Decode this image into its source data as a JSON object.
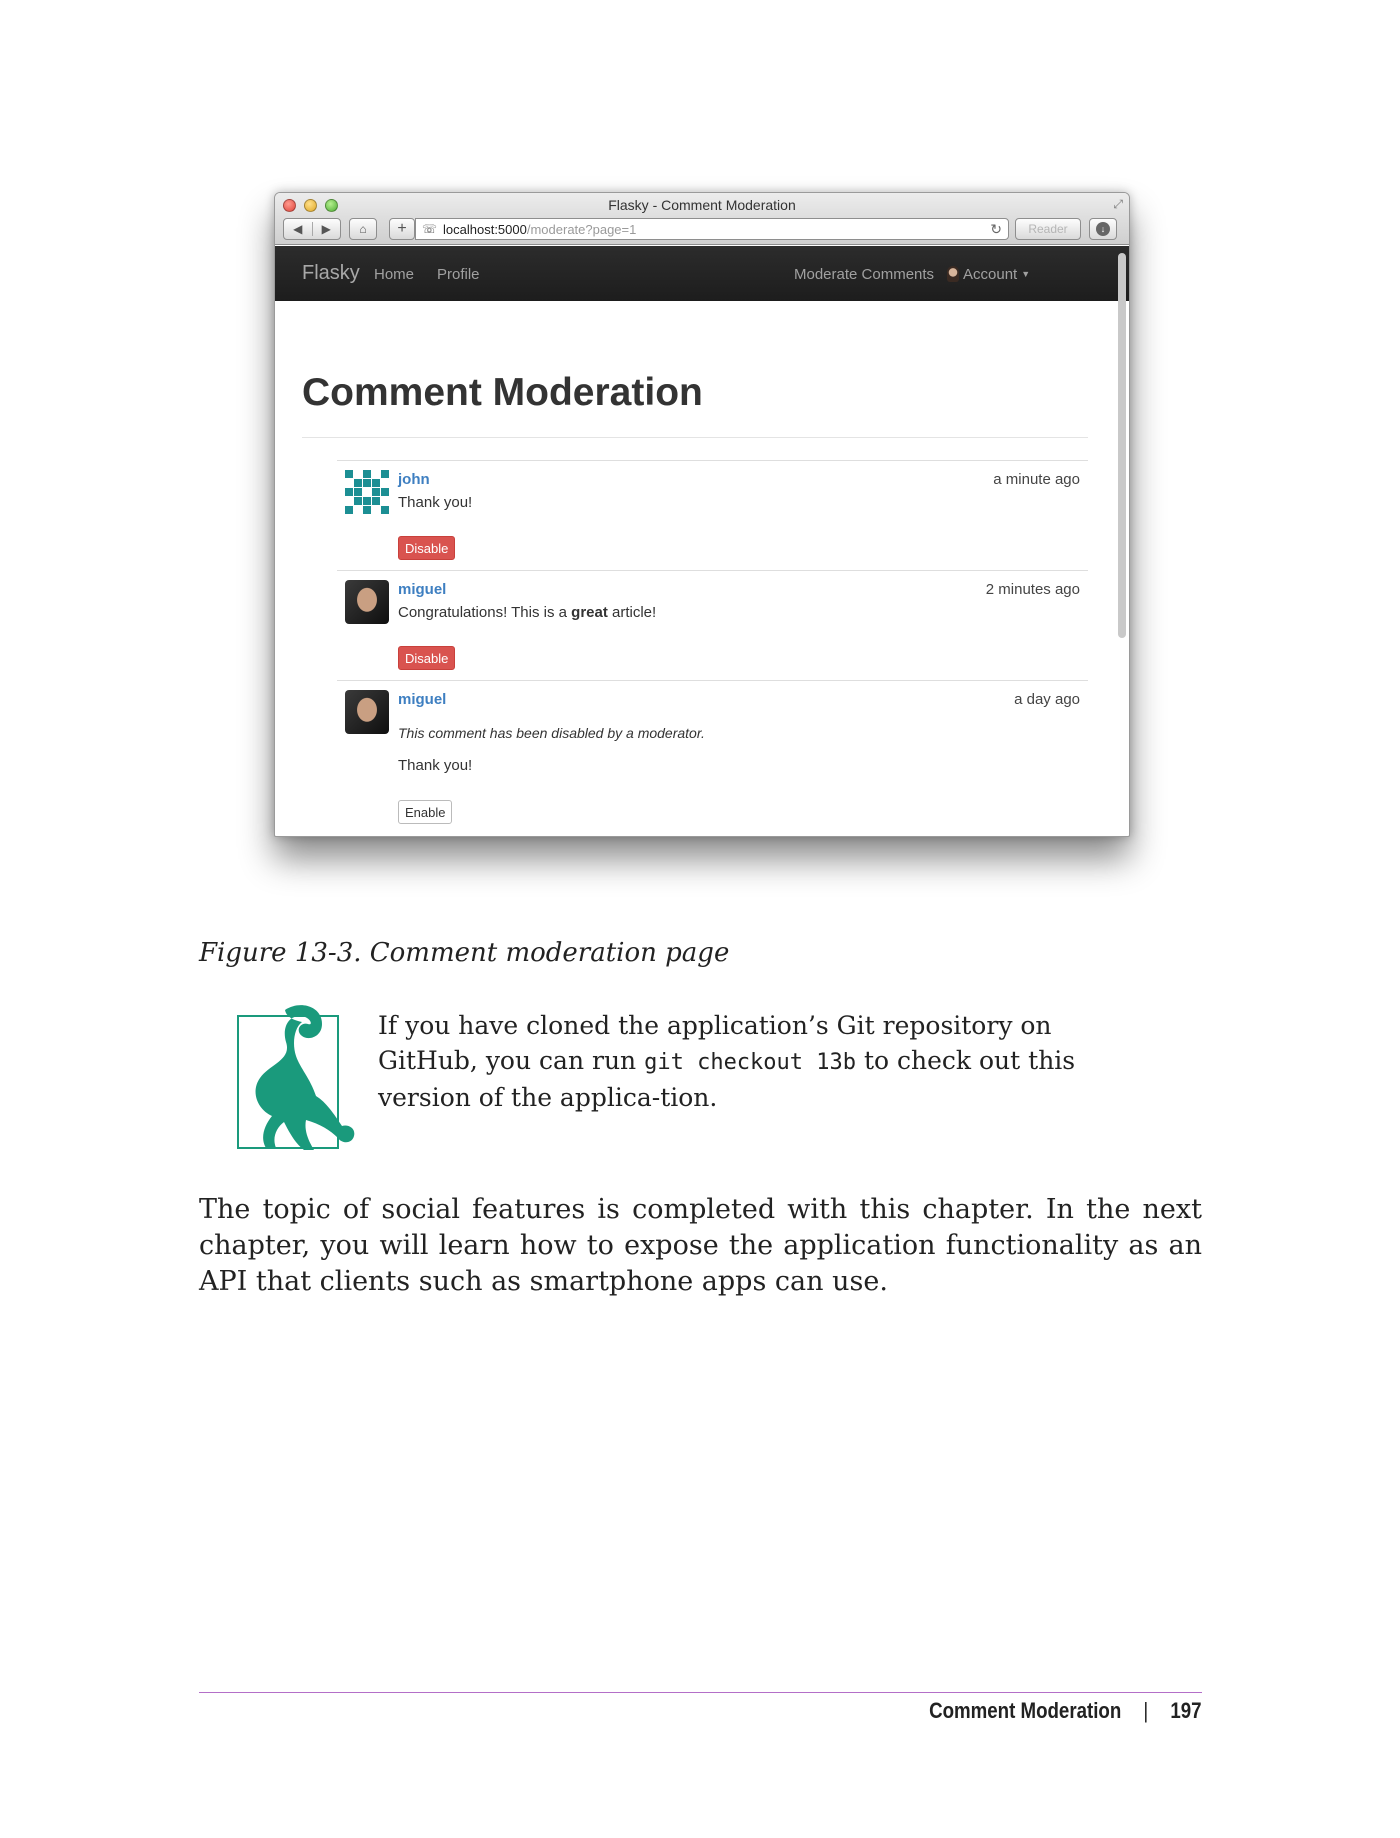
{
  "browser": {
    "window_title": "Flasky - Comment Moderation",
    "address_host": "localhost:5000",
    "address_path": "/moderate?page=1",
    "reader_label": "Reader"
  },
  "navbar": {
    "brand": "Flasky",
    "links": [
      "Home",
      "Profile"
    ],
    "moderate": "Moderate Comments",
    "account": "Account"
  },
  "page_title": "Comment Moderation",
  "comments": [
    {
      "author": "john",
      "date": "a minute ago",
      "body": "Thank you!",
      "button": "Disable",
      "avatar": "identicon-avatar"
    },
    {
      "author": "miguel",
      "date": "2 minutes ago",
      "body_before": "Congratulations! This is a ",
      "body_bold": "great",
      "body_after": " article!",
      "button": "Disable",
      "avatar": "photo-avatar"
    },
    {
      "author": "miguel",
      "date": "a day ago",
      "notice": "This comment has been disabled by a moderator.",
      "body": "Thank you!",
      "button": "Enable",
      "avatar": "photo-avatar"
    }
  ],
  "figure_caption": "Figure 13-3. Comment moderation page",
  "note": {
    "before": "If you have cloned the application’s Git repository on GitHub, you can run ",
    "code": "git checkout 13b",
    "after": " to check out this version of the applica-tion."
  },
  "paragraph": "The topic of social features is completed with this chapter. In the next chapter, you will learn how to expose the application functionality as an API that clients such as smartphone apps can use.",
  "footer": {
    "section": "Comment Moderation",
    "separator": "|",
    "page_number": "197"
  },
  "colors": {
    "link_blue": "#3e7fc1",
    "danger_red": "#d9534f",
    "lemur_green": "#1a9a7c",
    "footer_rule_purple": "#b46fc8"
  }
}
